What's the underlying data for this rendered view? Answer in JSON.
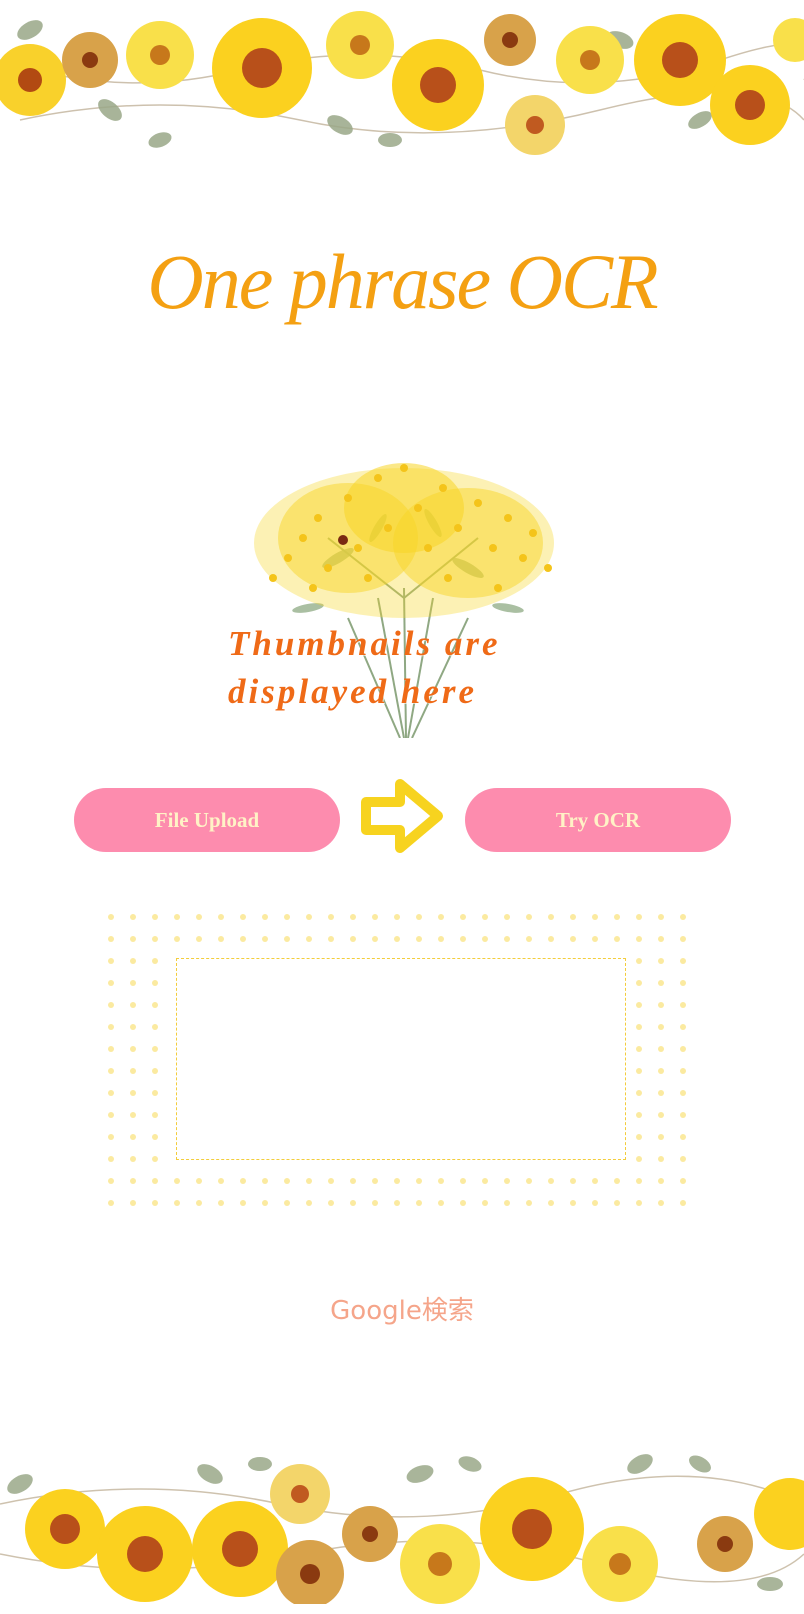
{
  "page": {
    "title": "One phrase OCR"
  },
  "thumbnail": {
    "placeholder_text": "Thumbnails are\ndisplayed here"
  },
  "actions": {
    "upload_label": "File Upload",
    "ocr_label": "Try OCR"
  },
  "result": {
    "text": ""
  },
  "footer": {
    "search_link_label": "Google検索"
  },
  "icons": {
    "flow_arrow": "arrow-right-icon",
    "top_banner": "floral-garland-icon",
    "bottom_banner": "floral-garland-icon",
    "bouquet": "mimosa-bouquet-icon"
  },
  "colors": {
    "title": "#f4a012",
    "thumbnail_text": "#ef6a17",
    "button_bg": "#fd8cae",
    "button_text": "#fff2c6",
    "arrow": "#f7d31f",
    "dots": "#fbeaa0",
    "dashed_border": "#f3cd3c",
    "link": "#f5a58a"
  }
}
